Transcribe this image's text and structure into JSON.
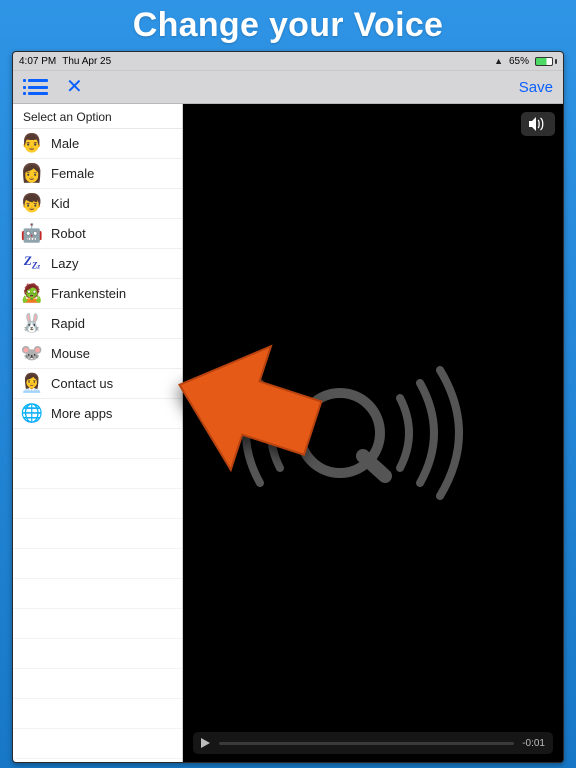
{
  "promo": {
    "title": "Change your Voice"
  },
  "statusbar": {
    "time": "4:07 PM",
    "date": "Thu Apr 25",
    "battery_pct": "65%"
  },
  "toolbar": {
    "save_label": "Save"
  },
  "sidebar": {
    "header": "Select an Option",
    "items": [
      {
        "label": "Male",
        "icon": "👨"
      },
      {
        "label": "Female",
        "icon": "👩"
      },
      {
        "label": "Kid",
        "icon": "👦"
      },
      {
        "label": "Robot",
        "icon": "🤖"
      },
      {
        "label": "Lazy",
        "icon": "zzz"
      },
      {
        "label": "Frankenstein",
        "icon": "🧟"
      },
      {
        "label": "Rapid",
        "icon": "🐰"
      },
      {
        "label": "Mouse",
        "icon": "🐭"
      },
      {
        "label": "Contact us",
        "icon": "👩‍💼"
      },
      {
        "label": "More apps",
        "icon": "🌐"
      }
    ]
  },
  "player": {
    "time_remaining": "-0:01"
  }
}
